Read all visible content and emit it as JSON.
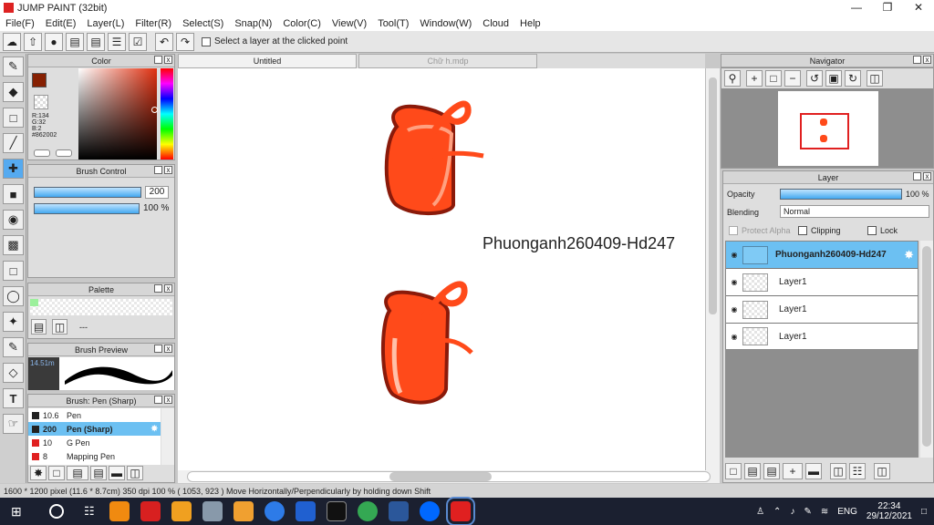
{
  "window": {
    "title": "JUMP PAINT (32bit)"
  },
  "menu": [
    "File(F)",
    "Edit(E)",
    "Layer(L)",
    "Filter(R)",
    "Select(S)",
    "Snap(N)",
    "Color(C)",
    "View(V)",
    "Tool(T)",
    "Window(W)",
    "Cloud",
    "Help"
  ],
  "toolbar": {
    "hint": "Select a layer at the clicked point"
  },
  "color_panel": {
    "title": "Color",
    "r": "R:134",
    "g": "G:32",
    "b": "B:2",
    "hex": "#862002",
    "primary": "#862002"
  },
  "brush_control": {
    "title": "Brush Control",
    "size": "200",
    "opacity": "100 %"
  },
  "palette": {
    "title": "Palette",
    "label": "---"
  },
  "brush_preview": {
    "title": "Brush Preview",
    "size": "14.51m"
  },
  "brush_list": {
    "title": "Brush: Pen (Sharp)",
    "items": [
      {
        "size": "10.6",
        "name": "Pen"
      },
      {
        "size": "200",
        "name": "Pen (Sharp)"
      },
      {
        "size": "10",
        "name": "G Pen"
      },
      {
        "size": "8",
        "name": "Mapping Pen"
      }
    ]
  },
  "tabs": [
    "Untitled",
    "Chữ h.mdp"
  ],
  "canvas": {
    "text": "Phuonganh260409-Hd247"
  },
  "navigator": {
    "title": "Navigator"
  },
  "layer_panel": {
    "title": "Layer",
    "opacity_label": "Opacity",
    "opacity_value": "100 %",
    "blending_label": "Blending",
    "blending_value": "Normal",
    "protect_alpha": "Protect Alpha",
    "clipping": "Clipping",
    "lock": "Lock",
    "layers": [
      "Phuonganh260409-Hd247",
      "Layer1",
      "Layer1",
      "Layer1"
    ]
  },
  "status": {
    "size": "1600 * 1200 pixel  (11.6 * 8.7cm)  350 dpi  100 %  ( 1053, 923 )  Move Horizontally/Perpendicularly by holding down Shift"
  },
  "taskbar": {
    "lang": "ENG",
    "time": "22:34",
    "date": "29/12/2021"
  }
}
